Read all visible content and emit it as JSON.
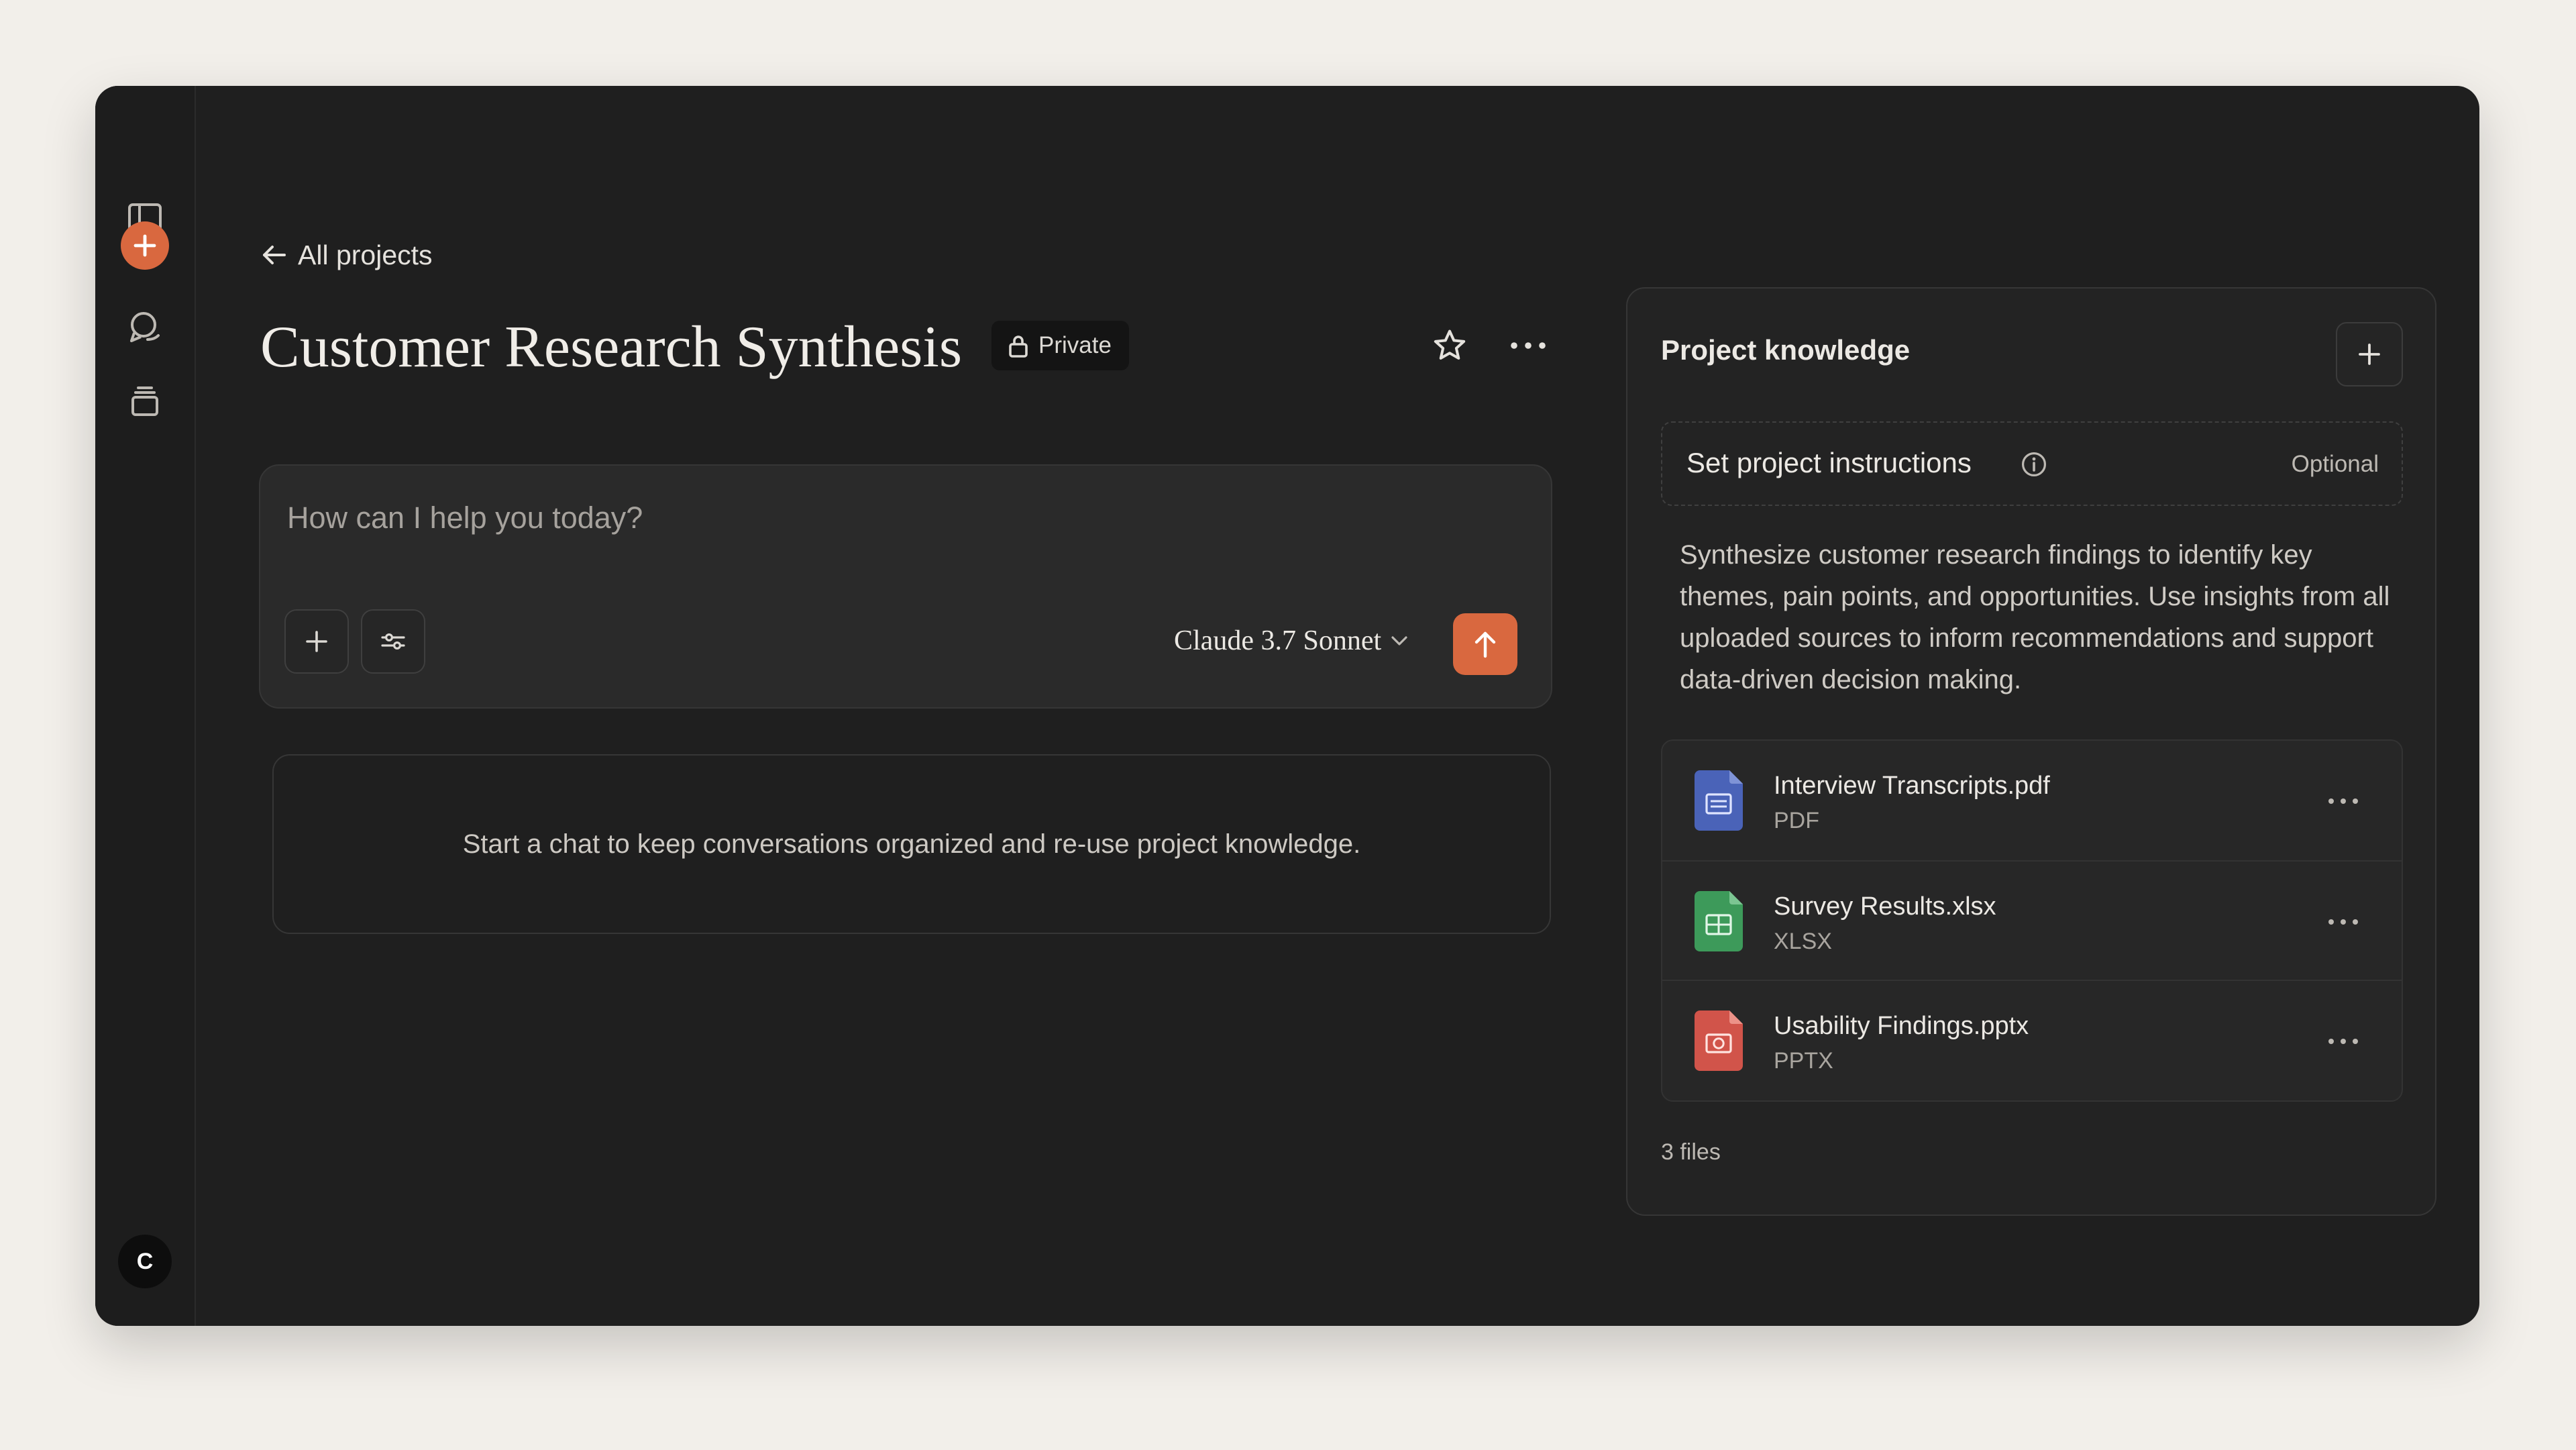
{
  "nav": {
    "back_label": "All projects"
  },
  "project": {
    "title": "Customer Research Synthesis",
    "visibility": "Private"
  },
  "composer": {
    "placeholder": "How can I help you today?",
    "model": "Claude 3.7 Sonnet"
  },
  "empty_state": {
    "message": "Start a chat to keep conversations organized and re-use project knowledge."
  },
  "knowledge": {
    "title": "Project knowledge",
    "instructions_label": "Set project instructions",
    "instructions_optional": "Optional",
    "description": "Synthesize customer research findings to identify key themes, pain points, and opportunities. Use insights from all uploaded sources to inform recommendations and support data-driven decision making.",
    "files": [
      {
        "name": "Interview Transcripts.pdf",
        "type": "PDF",
        "icon": "pdf-document-icon",
        "color": "#4a63b8"
      },
      {
        "name": "Survey Results.xlsx",
        "type": "XLSX",
        "icon": "spreadsheet-icon",
        "color": "#3d9a5a"
      },
      {
        "name": "Usability Findings.pptx",
        "type": "PPTX",
        "icon": "presentation-icon",
        "color": "#d1544a"
      }
    ],
    "file_count": "3 files"
  },
  "user": {
    "avatar_initial": "C"
  },
  "colors": {
    "accent": "#d9683f",
    "app_background": "#1f1f1f",
    "page_background": "#f2efea"
  }
}
